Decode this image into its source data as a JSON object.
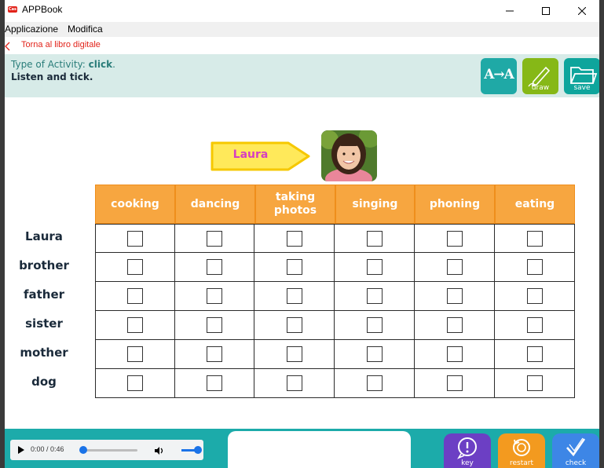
{
  "window": {
    "app_logo": "Cas",
    "title": "APPBook"
  },
  "menu": {
    "items": [
      {
        "label": "Applicazione"
      },
      {
        "label": "Modifica"
      }
    ]
  },
  "back": {
    "label": "Torna al libro digitale"
  },
  "activity": {
    "type_prefix": "Type of Activity: ",
    "type_value": "click",
    "type_suffix": ".",
    "instruction": "Listen and tick."
  },
  "tools": {
    "font_glyph": "A→A",
    "draw_label": "draw",
    "save_label": "save"
  },
  "tag": {
    "name": "Laura"
  },
  "grid": {
    "columns": [
      {
        "label": "cooking"
      },
      {
        "label": "dancing"
      },
      {
        "label": "taking photos"
      },
      {
        "label": "singing"
      },
      {
        "label": "phoning"
      },
      {
        "label": "eating"
      }
    ],
    "rows": [
      {
        "label": "Laura"
      },
      {
        "label": "brother"
      },
      {
        "label": "father"
      },
      {
        "label": "sister"
      },
      {
        "label": "mother"
      },
      {
        "label": "dog"
      }
    ]
  },
  "player": {
    "time": "0:00 / 0:46",
    "progress": 0,
    "volume": 1
  },
  "footer": {
    "key_label": "key",
    "restart_label": "restart",
    "check_label": "check"
  },
  "colors": {
    "accent_red": "#e2231a",
    "header_orange": "#f7a640",
    "teal": "#1cabaa",
    "tag_yellow": "#ffe95a",
    "tag_text": "#d63fc0"
  }
}
